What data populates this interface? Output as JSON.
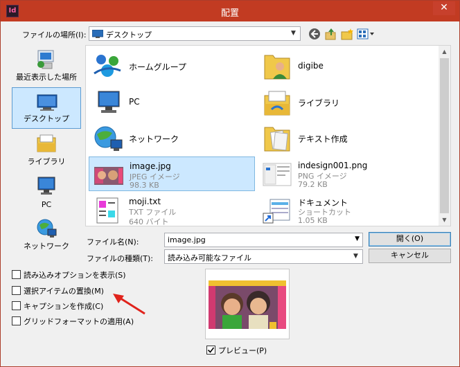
{
  "window": {
    "title": "配置",
    "app_icon": "Id",
    "close": "✕"
  },
  "location": {
    "label": "ファイルの場所(I):",
    "value": "デスクトップ"
  },
  "toolbar": {
    "icons": [
      "back-icon",
      "up-folder-icon",
      "new-folder-icon",
      "view-menu-icon"
    ]
  },
  "places": [
    {
      "label": "最近表示した場所",
      "icon": "recent-places-icon"
    },
    {
      "label": "デスクトップ",
      "icon": "desktop-icon",
      "selected": true
    },
    {
      "label": "ライブラリ",
      "icon": "libraries-icon"
    },
    {
      "label": "PC",
      "icon": "pc-icon"
    },
    {
      "label": "ネットワーク",
      "icon": "network-icon"
    }
  ],
  "files": [
    {
      "name": "ホームグループ",
      "icon": "homegroup-icon"
    },
    {
      "name": "digibe",
      "icon": "user-folder-icon"
    },
    {
      "name": "PC",
      "icon": "pc-icon"
    },
    {
      "name": "ライブラリ",
      "icon": "libraries-icon"
    },
    {
      "name": "ネットワーク",
      "icon": "network-icon"
    },
    {
      "name": "テキスト作成",
      "icon": "folder-icon"
    },
    {
      "name": "image.jpg",
      "type": "JPEG イメージ",
      "size": "98.3 KB",
      "icon": "jpeg-thumbnail-icon",
      "selected": true
    },
    {
      "name": "indesign001.png",
      "type": "PNG イメージ",
      "size": "79.2 KB",
      "icon": "png-thumbnail-icon"
    },
    {
      "name": "moji.txt",
      "type": "TXT ファイル",
      "size": "640 バイト",
      "icon": "text-file-icon"
    },
    {
      "name": "ドキュメント",
      "type": "ショートカット",
      "size": "1.05 KB",
      "icon": "shortcut-icon"
    }
  ],
  "filename": {
    "label": "ファイル名(N):",
    "value": "image.jpg"
  },
  "filetype": {
    "label": "ファイルの種類(T):",
    "value": "読み込み可能なファイル"
  },
  "buttons": {
    "open": "開く(O)",
    "cancel": "キャンセル"
  },
  "options": [
    {
      "label": "読み込みオプションを表示(S)",
      "checked": false
    },
    {
      "label": "選択アイテムの置換(M)",
      "checked": false
    },
    {
      "label": "キャプションを作成(C)",
      "checked": false
    },
    {
      "label": "グリッドフォーマットの適用(A)",
      "checked": false
    }
  ],
  "preview": {
    "label": "プレビュー(P)",
    "checked": true
  },
  "colors": {
    "titlebar": "#c23b22",
    "selection": "#cce8ff",
    "annotation_arrow": "#e0231c"
  }
}
